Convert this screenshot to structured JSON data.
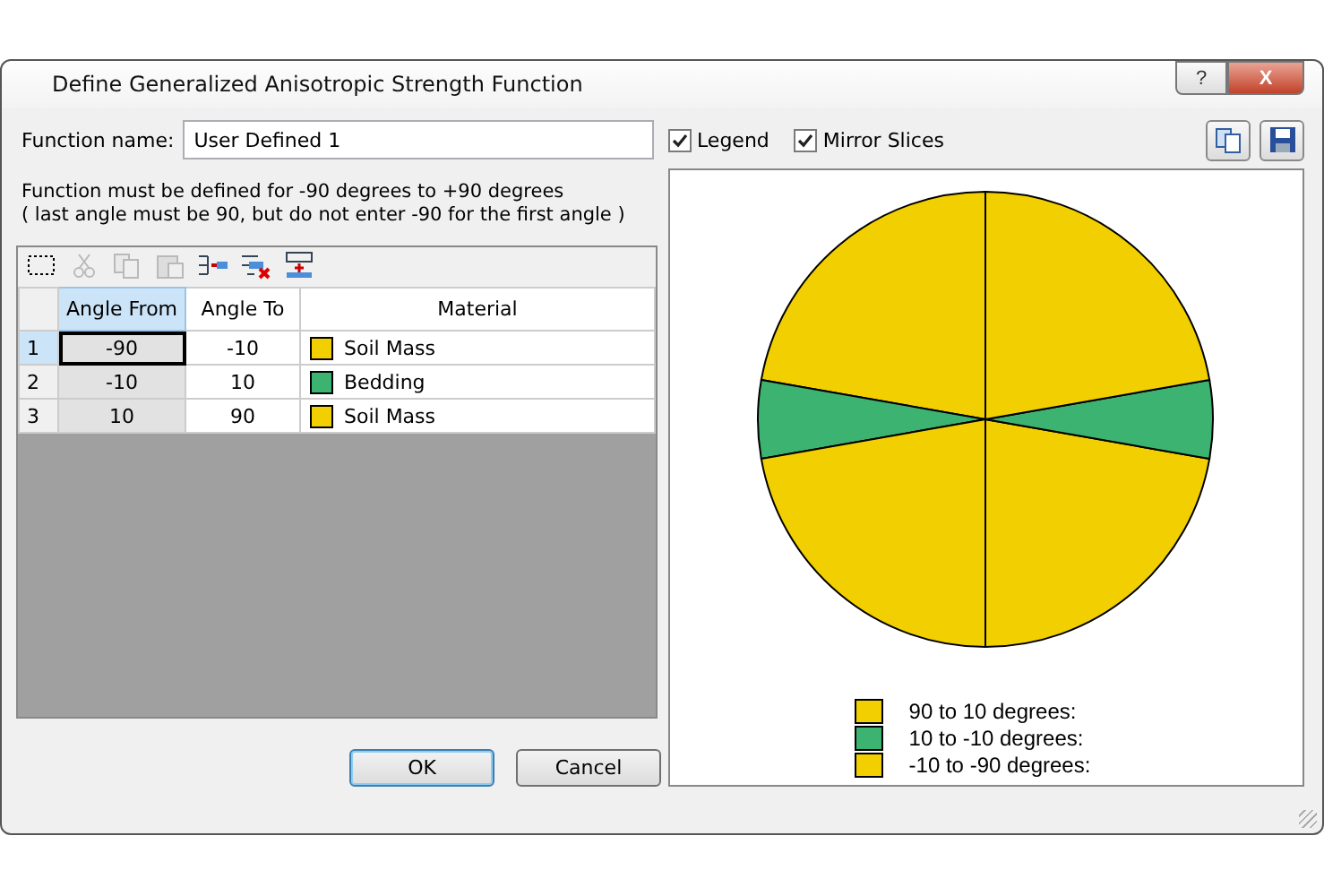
{
  "window": {
    "title": "Define Generalized Anisotropic Strength Function",
    "help": "?",
    "close": "X"
  },
  "function_name": {
    "label": "Function name:",
    "value": "User Defined 1"
  },
  "options": [
    {
      "label": "Legend",
      "checked": true
    },
    {
      "label": "Mirror Slices",
      "checked": true
    }
  ],
  "note": [
    "Function must be defined for -90 degrees to +90 degrees",
    "( last angle must be 90, but do not enter -90 for the first angle )"
  ],
  "toolbar": [
    {
      "kind": "select",
      "disabled": false
    },
    {
      "kind": "cut",
      "disabled": true
    },
    {
      "kind": "copy",
      "disabled": true
    },
    {
      "kind": "paste",
      "disabled": true
    },
    {
      "kind": "insert",
      "disabled": false
    },
    {
      "kind": "delete",
      "disabled": false
    },
    {
      "kind": "append",
      "disabled": false
    }
  ],
  "table": {
    "columns": [
      {
        "label": "Angle From",
        "selected": true
      },
      {
        "label": "Angle To",
        "selected": false
      },
      {
        "label": "Material",
        "selected": false
      }
    ],
    "rows": [
      {
        "index": "1",
        "from": "-90",
        "to": "-10",
        "material": "Soil Mass",
        "color": "#f2cf00",
        "selected": true
      },
      {
        "index": "2",
        "from": "-10",
        "to": "10",
        "material": "Bedding",
        "color": "#3cb371",
        "selected": false
      },
      {
        "index": "3",
        "from": "10",
        "to": "90",
        "material": "Soil Mass",
        "color": "#f2cf00",
        "selected": false
      }
    ]
  },
  "legend": [
    {
      "label": "90 to 10 degrees:",
      "color": "#f2cf00"
    },
    {
      "label": "10 to -10 degrees:",
      "color": "#3cb371"
    },
    {
      "label": "-10 to -90 degrees:",
      "color": "#f2cf00"
    }
  ],
  "buttons": [
    {
      "label": "OK",
      "default": true
    },
    {
      "label": "Cancel",
      "default": false
    }
  ]
}
